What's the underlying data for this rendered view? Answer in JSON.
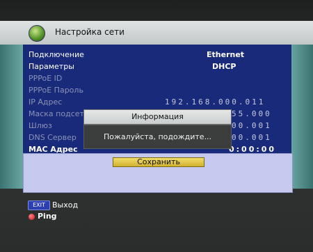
{
  "header": {
    "title": "Настройка сети",
    "icon": "globe-icon"
  },
  "settings": [
    {
      "label": "Подключение",
      "value": "Ethernet",
      "enabled": true
    },
    {
      "label": "Параметры",
      "value": "DHCP",
      "enabled": true
    },
    {
      "label": "PPPoE ID",
      "value": "",
      "enabled": false
    },
    {
      "label": "PPPoE Пароль",
      "value": "",
      "enabled": false
    },
    {
      "label": "IP Адрес",
      "value": "192.168.000.011",
      "enabled": false
    },
    {
      "label": "Маска подсети",
      "value": "55.000",
      "enabled": false
    },
    {
      "label": "Шлюз",
      "value": "00.001",
      "enabled": false
    },
    {
      "label": "DNS Сервер",
      "value": "00.001",
      "enabled": false
    },
    {
      "label": "MAC Адрес",
      "value": "0:00:00",
      "enabled": true
    }
  ],
  "save_button": "Сохранить",
  "dialog": {
    "title": "Информация",
    "message": "Пожалуйста, подождите..."
  },
  "footer": {
    "exit_key": "EXIT",
    "exit_label": "Выход",
    "ping_label": "Ping"
  },
  "colors": {
    "panel": "#1a2a7a",
    "header": "#d4d8d8",
    "save_button": "#e3c84a",
    "sides": "#5b9a97"
  }
}
